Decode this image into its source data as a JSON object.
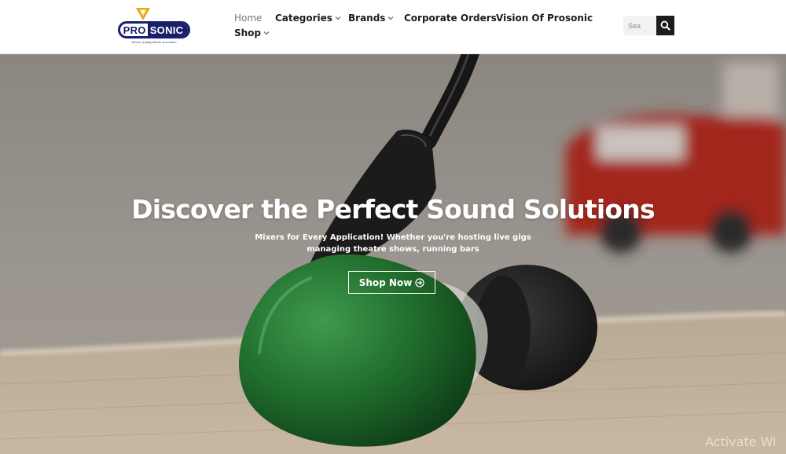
{
  "logo": {
    "part1": "PRO",
    "part2": "SONIC",
    "tagline": "Where Quality Meets Innovation"
  },
  "nav": {
    "home": "Home",
    "categories": "Categories",
    "brands": "Brands",
    "corporate_orders": "Corporate Orders",
    "vision": "Vision Of Prosonic",
    "shop": "Shop"
  },
  "search": {
    "placeholder": "Sea"
  },
  "hero": {
    "title": "Discover the Perfect Sound Solutions",
    "subtitle_line1": "Mixers for Every Application! Whether you're hosting live gigs",
    "subtitle_line2": "managing theatre shows, running bars",
    "cta_label": "Shop Now"
  },
  "watermark": "Activate Wi",
  "colors": {
    "brand_navy": "#1a1f6b",
    "brand_gold": "#e8a317",
    "earphone_green": "#1f6b2b",
    "search_button": "#1c1c1c"
  },
  "icons": {
    "search": "search-icon",
    "dropdown": "chevron-down-icon",
    "cta": "arrow-circle-right-icon"
  }
}
